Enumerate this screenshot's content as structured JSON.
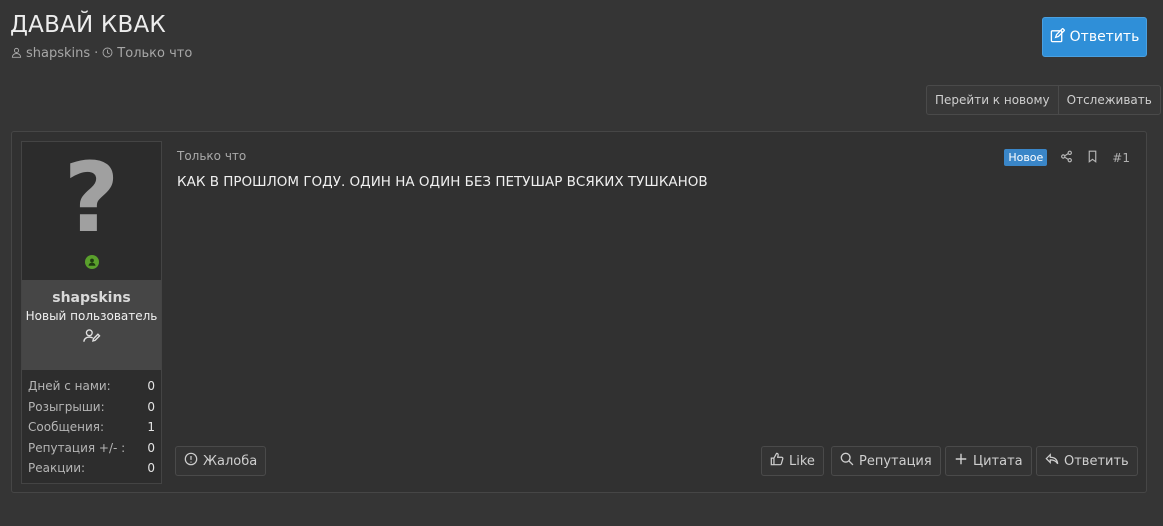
{
  "thread": {
    "title": "ДАВАЙ КВАК",
    "author": "shapskins",
    "separator": "·",
    "time": "Только что"
  },
  "header_buttons": {
    "reply": "Ответить",
    "goto_new": "Перейти к новому",
    "watch": "Отслеживать"
  },
  "post": {
    "date": "Только что",
    "badge": "Новое",
    "number": "#1",
    "body": "КАК В ПРОШЛОМ ГОДУ. ОДИН НА ОДИН БЕЗ ПЕТУШАР ВСЯКИХ ТУШКАНОВ",
    "avatar_glyph": "?"
  },
  "user": {
    "name": "shapskins",
    "title": "Новый пользователь",
    "stats": [
      {
        "label": "Дней с нами:",
        "value": "0"
      },
      {
        "label": "Розыгрыши:",
        "value": "0"
      },
      {
        "label": "Сообщения:",
        "value": "1"
      },
      {
        "label": "Репутация +/- :",
        "value": "0"
      },
      {
        "label": "Реакции:",
        "value": "0"
      }
    ]
  },
  "footer_buttons": {
    "report": "Жалоба",
    "like": "Like",
    "reputation": "Репутация",
    "quote": "Цитата",
    "reply": "Ответить"
  },
  "colors": {
    "background": "#353535",
    "accent": "#2f8fd8",
    "online": "#5aa02c",
    "badge": "#3a86c8"
  },
  "icons": [
    "user-icon",
    "clock-icon",
    "edit-icon",
    "share-icon",
    "bookmark-icon",
    "user-edit-icon",
    "alert-icon",
    "thumbs-up-icon",
    "search-icon",
    "plus-icon",
    "reply-icon"
  ]
}
